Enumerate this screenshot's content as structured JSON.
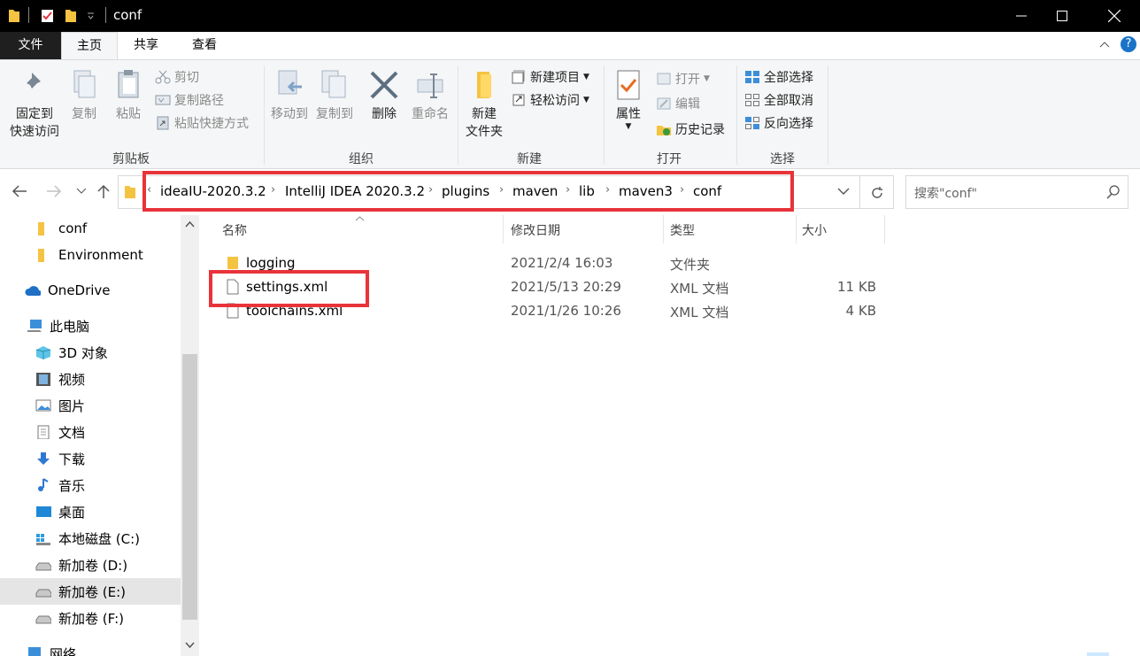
{
  "window": {
    "title": "conf"
  },
  "tabs": [
    "文件",
    "主页",
    "共享",
    "查看"
  ],
  "ribbon": {
    "clipboard": {
      "pin": "固定到",
      "pin2": "快速访问",
      "copy": "复制",
      "paste": "粘贴",
      "cut": "剪切",
      "copy_path": "复制路径",
      "paste_shortcut": "粘贴快捷方式",
      "label": "剪贴板"
    },
    "organize": {
      "move_to": "移动到",
      "copy_to": "复制到",
      "delete": "删除",
      "rename": "重命名",
      "label": "组织"
    },
    "new": {
      "new_folder": "新建",
      "new_folder2": "文件夹",
      "new_item": "新建项目",
      "easy_access": "轻松访问",
      "label": "新建"
    },
    "open": {
      "properties": "属性",
      "open": "打开",
      "edit": "编辑",
      "history": "历史记录",
      "label": "打开"
    },
    "select": {
      "select_all": "全部选择",
      "select_none": "全部取消",
      "invert": "反向选择",
      "label": "选择"
    }
  },
  "address": {
    "overflow": "‹",
    "crumbs": [
      "ideaIU-2020.3.2",
      "IntelliJ IDEA 2020.3.2",
      "plugins",
      "maven",
      "lib",
      "maven3",
      "conf"
    ]
  },
  "search": {
    "placeholder": "搜索\"conf\""
  },
  "nav": {
    "items": [
      "conf",
      "Environment",
      "OneDrive",
      "此电脑",
      "3D 对象",
      "视频",
      "图片",
      "文档",
      "下载",
      "音乐",
      "桌面",
      "本地磁盘 (C:)",
      "新加卷 (D:)",
      "新加卷 (E:)",
      "新加卷 (F:)",
      "网络"
    ]
  },
  "columns": {
    "name": "名称",
    "date": "修改日期",
    "type": "类型",
    "size": "大小"
  },
  "files": [
    {
      "name": "logging",
      "date": "2021/2/4 16:03",
      "type": "文件夹",
      "size": ""
    },
    {
      "name": "settings.xml",
      "date": "2021/5/13 20:29",
      "type": "XML 文档",
      "size": "11 KB"
    },
    {
      "name": "toolchains.xml",
      "date": "2021/1/26 10:26",
      "type": "XML 文档",
      "size": "4 KB"
    }
  ],
  "colors": {
    "highlight": "#e8333a",
    "titlebar": "#000000",
    "folder": "#f5c342"
  }
}
